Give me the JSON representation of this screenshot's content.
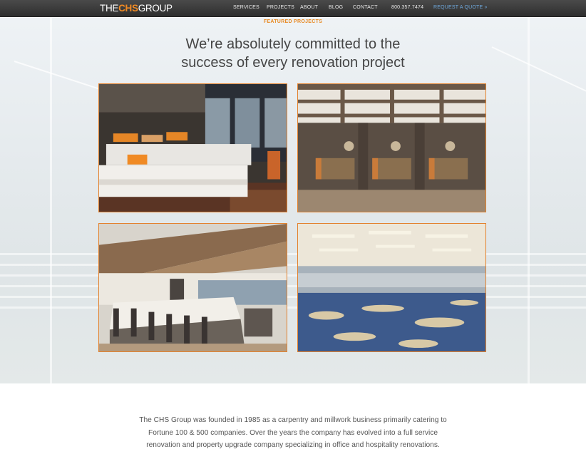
{
  "header": {
    "logo_part1": "THE",
    "logo_part2": "CHS",
    "logo_part3": "GROUP",
    "nav": [
      "SERVICES",
      "PROJECTS",
      "ABOUT",
      "BLOG",
      "CONTACT"
    ],
    "phone": "800.357.7474",
    "cta": "REQUEST A QUOTE »"
  },
  "featured": {
    "kicker": "FEATURED PROJECTS",
    "headline_line1": "We’re absolutely committed to the",
    "headline_line2": "success of every renovation project"
  },
  "about": {
    "text": "The CHS Group was founded in 1985 as a carpentry and millwork business primarily catering to Fortune 100 & 500 companies. Over the years the company has evolved into a full service renovation and property upgrade company specializing in office and hospitality renovations."
  },
  "colors": {
    "accent": "#f08a24",
    "nav_bg": "#333333",
    "cta": "#6fa8dc"
  }
}
